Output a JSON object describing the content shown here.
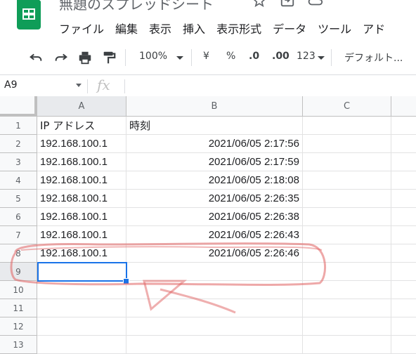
{
  "app": {
    "doc_title": "無題のスプレッドシート",
    "logo_icon": "sheets-logo-icon",
    "brand_color": "#0f9d58"
  },
  "menu": [
    "ファイル",
    "編集",
    "表示",
    "挿入",
    "表示形式",
    "データ",
    "ツール",
    "アド"
  ],
  "toolbar": {
    "zoom": "100%",
    "currency": "¥",
    "percent": "%",
    "dec_decrease": ".0",
    "dec_increase": ".00",
    "number_format": "123",
    "font": "デフォルト..."
  },
  "formula_bar": {
    "name_box": "A9",
    "fx_symbol": "fx",
    "formula": ""
  },
  "columns": [
    "A",
    "B",
    "C"
  ],
  "rows": [
    "1",
    "2",
    "3",
    "4",
    "5",
    "6",
    "7",
    "8",
    "9",
    "10",
    "11",
    "12",
    "13"
  ],
  "cells": {
    "headers": [
      "IP アドレス",
      "時刻"
    ],
    "data": [
      [
        "192.168.100.1",
        "2021/06/05 2:17:56"
      ],
      [
        "192.168.100.1",
        "2021/06/05 2:17:59"
      ],
      [
        "192.168.100.1",
        "2021/06/05 2:18:08"
      ],
      [
        "192.168.100.1",
        "2021/06/05 2:26:35"
      ],
      [
        "192.168.100.1",
        "2021/06/05 2:26:38"
      ],
      [
        "192.168.100.1",
        "2021/06/05 2:26:43"
      ],
      [
        "192.168.100.1",
        "2021/06/05 2:26:46"
      ]
    ]
  },
  "selection": {
    "cell": "A9",
    "color": "#1a73e8"
  },
  "annotation": {
    "color": "#e06060"
  }
}
